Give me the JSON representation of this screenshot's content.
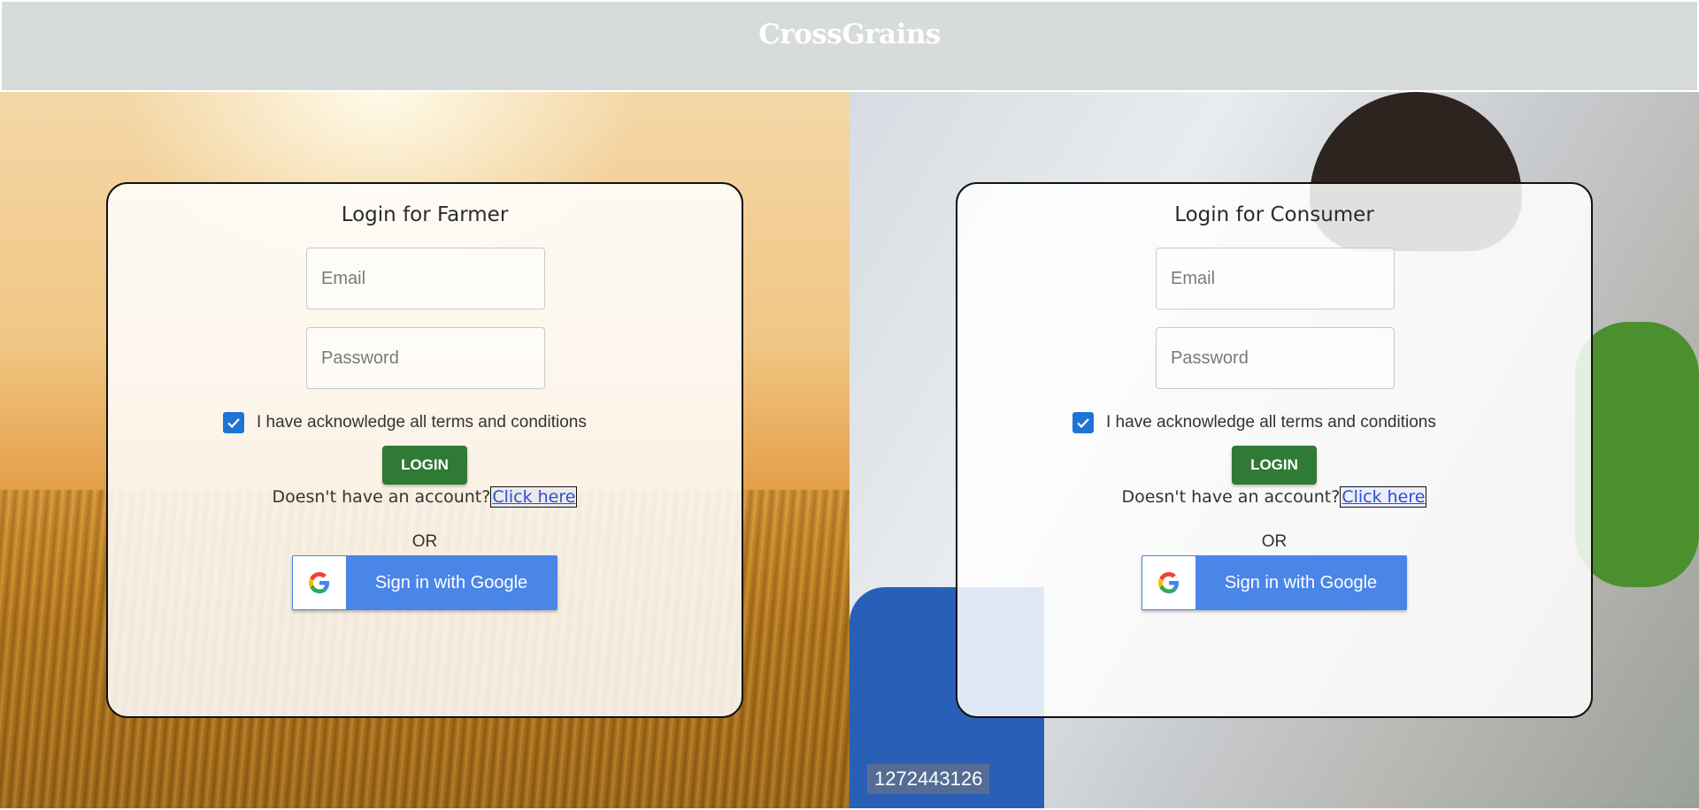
{
  "header": {
    "brand": "CrossGrains"
  },
  "farmer": {
    "title": "Login for Farmer",
    "email_placeholder": "Email",
    "password_placeholder": "Password",
    "terms_label": "I have acknowledge all terms and conditions",
    "terms_checked": true,
    "login_label": "LOGIN",
    "account_prompt": "Doesn't have an account?",
    "signup_link": "Click here",
    "or_label": "OR",
    "google_label": "Sign in with Google"
  },
  "consumer": {
    "title": "Login for Consumer",
    "email_placeholder": "Email",
    "password_placeholder": "Password",
    "terms_label": "I have acknowledge all terms and conditions",
    "terms_checked": true,
    "login_label": "LOGIN",
    "account_prompt": "Doesn't have an account?",
    "signup_link": "Click here",
    "or_label": "OR",
    "google_label": "Sign in with Google",
    "image_id_label": "1272443126"
  },
  "colors": {
    "header_bg": "#d7dbd9",
    "login_button": "#2f7a34",
    "google_button": "#4a85e8",
    "checkbox": "#1e73d6",
    "link": "#2d4fd1"
  },
  "icons": {
    "checkbox": "checkmark-icon",
    "google": "google-logo-icon"
  }
}
